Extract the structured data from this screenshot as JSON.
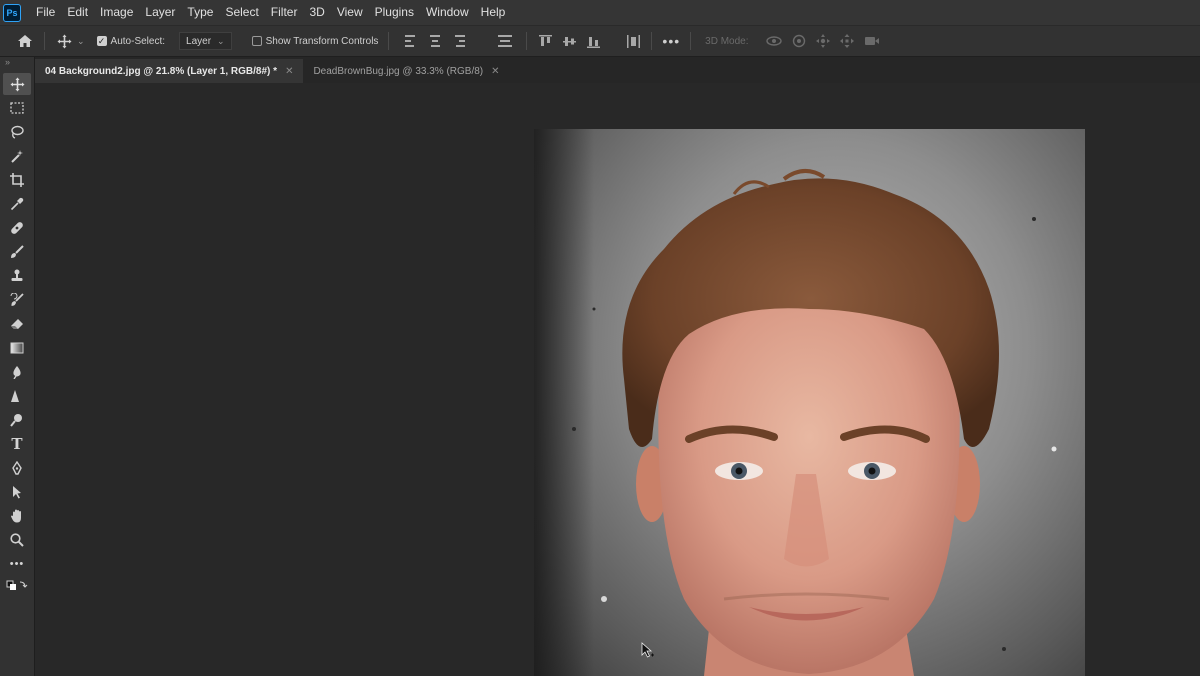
{
  "menu": [
    "File",
    "Edit",
    "Image",
    "Layer",
    "Type",
    "Select",
    "Filter",
    "3D",
    "View",
    "Plugins",
    "Window",
    "Help"
  ],
  "logo": "Ps",
  "options": {
    "auto_select_label": "Auto-Select:",
    "auto_select_checked": true,
    "layer_dropdown": "Layer",
    "transform_controls_label": "Show Transform Controls",
    "mode_label": "3D Mode:"
  },
  "tabs": [
    {
      "label": "04 Background2.jpg @ 21.8% (Layer 1, RGB/8#) *",
      "active": true
    },
    {
      "label": "DeadBrownBug.jpg @ 33.3% (RGB/8)",
      "active": false
    }
  ],
  "tools": [
    "move-tool",
    "marquee-tool",
    "lasso-tool",
    "magic-wand-tool",
    "crop-tool",
    "eyedropper-tool",
    "healing-brush-tool",
    "brush-tool",
    "stamp-tool",
    "history-brush-tool",
    "eraser-tool",
    "gradient-tool",
    "blur-tool",
    "dodge-tool",
    "pen-tool",
    "type-tool",
    "path-select-tool",
    "hand-tool",
    "zoom-tool",
    "more-tools"
  ]
}
